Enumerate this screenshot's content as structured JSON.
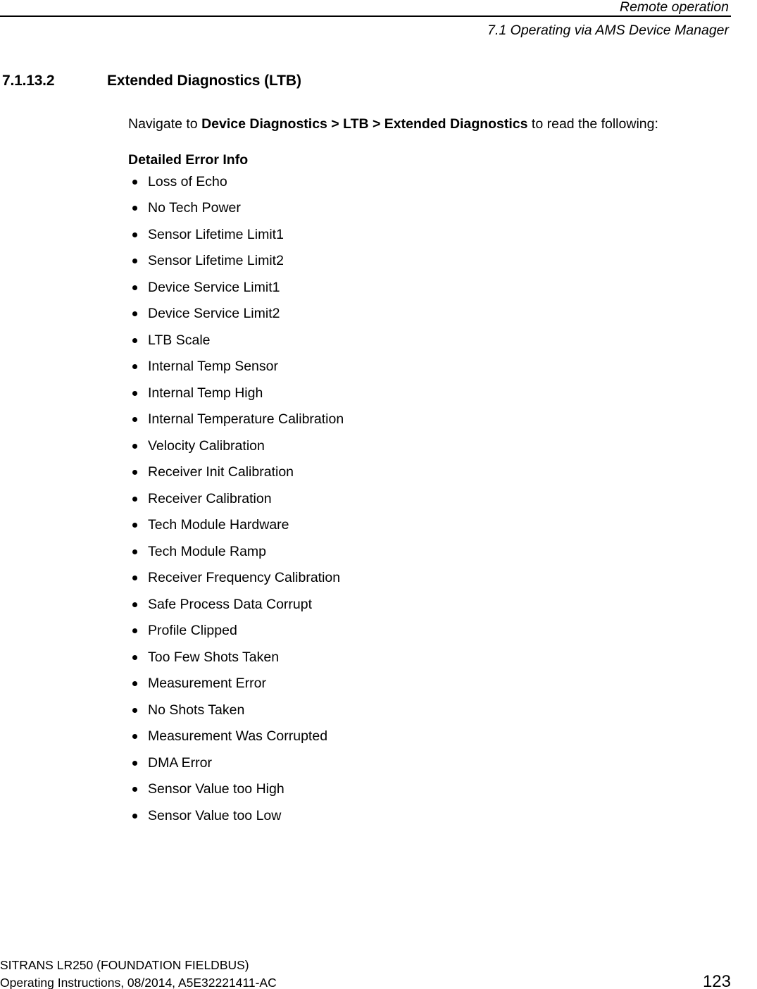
{
  "header": {
    "chapter_title": "Remote operation",
    "section_title": "7.1 Operating via AMS Device Manager"
  },
  "section": {
    "number": "7.1.13.2",
    "title": "Extended Diagnostics (LTB)"
  },
  "intro": {
    "prefix": "Navigate to ",
    "path": "Device Diagnostics > LTB > Extended Diagnostics",
    "suffix": " to read the following:"
  },
  "list": {
    "heading": "Detailed Error Info",
    "items": [
      "Loss of Echo",
      "No Tech Power",
      "Sensor Lifetime Limit1",
      "Sensor Lifetime Limit2",
      "Device Service Limit1",
      "Device Service Limit2",
      "LTB Scale",
      "Internal Temp Sensor",
      "Internal Temp High",
      "Internal Temperature Calibration",
      "Velocity Calibration",
      "Receiver Init Calibration",
      "Receiver Calibration",
      "Tech Module Hardware",
      "Tech Module Ramp",
      "Receiver Frequency Calibration",
      "Safe Process Data Corrupt",
      "Profile Clipped",
      "Too Few Shots Taken",
      "Measurement Error",
      "No Shots Taken",
      "Measurement Was Corrupted",
      "DMA Error",
      "Sensor Value too High",
      "Sensor Value too Low"
    ]
  },
  "footer": {
    "product_line": "SITRANS LR250 (FOUNDATION FIELDBUS)",
    "document_line": "Operating Instructions, 08/2014, A5E32221411-AC",
    "page_number": "123"
  }
}
